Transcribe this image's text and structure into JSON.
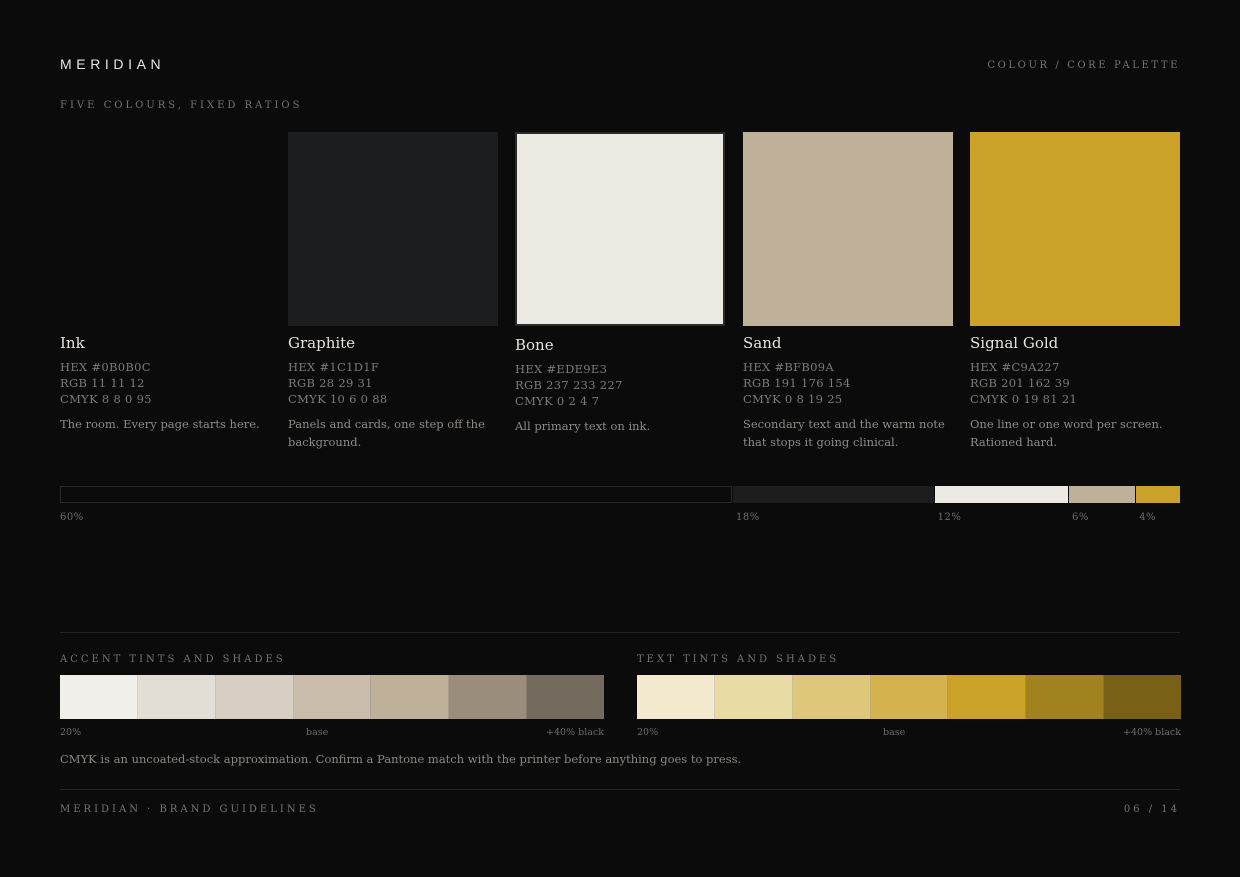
{
  "header": {
    "brand": "MERIDIAN",
    "section": "COLOUR / CORE PALETTE",
    "kicker": "FIVE COLOURS, FIXED RATIOS"
  },
  "palette": [
    {
      "name": "Ink",
      "hex": "HEX #0B0B0C",
      "rgb": "RGB 11 11 12",
      "cmyk": "CMYK 8 8 0 95",
      "description": "The room. Every page starts here.",
      "color": "#0B0B0C"
    },
    {
      "name": "Graphite",
      "hex": "HEX #1C1D1F",
      "rgb": "RGB 28 29 31",
      "cmyk": "CMYK 10 6 0 88",
      "description": "Panels and cards, one step off the background.",
      "color": "#1C1D1F"
    },
    {
      "name": "Bone",
      "hex": "HEX #EDE9E3",
      "rgb": "RGB 237 233 227",
      "cmyk": "CMYK 0 2 4 7",
      "description": "All primary text on ink.",
      "color": "#EDE9E3"
    },
    {
      "name": "Sand",
      "hex": "HEX #BFB09A",
      "rgb": "RGB 191 176 154",
      "cmyk": "CMYK 0 8 19 25",
      "description": "Secondary text and the warm note that stops it going clinical.",
      "color": "#BFB09A"
    },
    {
      "name": "Signal Gold",
      "hex": "HEX #C9A227",
      "rgb": "RGB 201 162 39",
      "cmyk": "CMYK 0 19 81 21",
      "description": "One line or one word per screen. Rationed hard.",
      "color": "#C9A227"
    }
  ],
  "ratios": [
    {
      "label": "60%",
      "value": 60,
      "color": "#0B0B0C"
    },
    {
      "label": "18%",
      "value": 18,
      "color": "#1C1D1F"
    },
    {
      "label": "12%",
      "value": 12,
      "color": "#EDE9E3"
    },
    {
      "label": "6%",
      "value": 6,
      "color": "#BFB09A"
    },
    {
      "label": "4%",
      "value": 4,
      "color": "#C9A227"
    }
  ],
  "accent_ramp": {
    "title": "ACCENT TINTS AND SHADES",
    "colors": [
      "#F1EFEA",
      "#E3DED5",
      "#D8CFC4",
      "#CBBDAC",
      "#BFB09A",
      "#9A8D7B",
      "#746A5E"
    ],
    "label_start": "20%",
    "label_mid": "base",
    "label_end": "+40% black"
  },
  "text_ramp": {
    "title": "TEXT TINTS AND SHADES",
    "colors": [
      "#F3E9CE",
      "#E8DBA4",
      "#DEC77A",
      "#D4B24E",
      "#C9A227",
      "#A2821F",
      "#786016"
    ],
    "label_start": "20%",
    "label_mid": "base",
    "label_end": "+40% black"
  },
  "note": "CMYK is an uncoated-stock approximation. Confirm a Pantone match with the printer before anything goes to press.",
  "footer": {
    "left": "MERIDIAN · BRAND GUIDELINES",
    "right": "06 / 14"
  }
}
